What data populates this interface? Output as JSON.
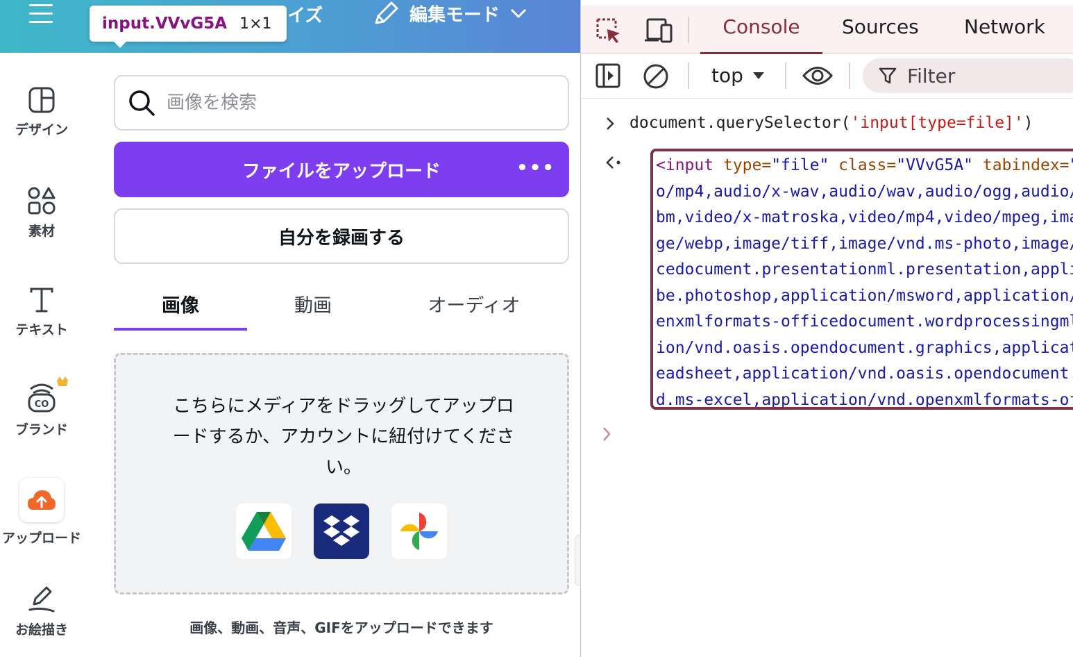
{
  "canva": {
    "topbar": {
      "resize_fragment": "イズ",
      "edit_mode_label": "編集モード"
    },
    "tooltip": {
      "element": "input.VVvG5A",
      "size": "1×1"
    },
    "sidebar": {
      "items": [
        {
          "label": "デザイン",
          "icon": "layout-icon"
        },
        {
          "label": "素材",
          "icon": "shapes-icon"
        },
        {
          "label": "テキスト",
          "icon": "text-icon"
        },
        {
          "label": "ブランド",
          "icon": "brand-icon"
        },
        {
          "label": "アップロード",
          "icon": "cloud-upload-icon"
        },
        {
          "label": "お絵描き",
          "icon": "draw-icon"
        }
      ]
    },
    "search": {
      "placeholder": "画像を検索"
    },
    "upload_button": {
      "label": "ファイルをアップロード",
      "more": "•••"
    },
    "record_button": {
      "label": "自分を録画する"
    },
    "tabs": [
      {
        "label": "画像",
        "active": true
      },
      {
        "label": "動画",
        "active": false
      },
      {
        "label": "オーディオ",
        "active": false
      }
    ],
    "dropzone": {
      "text": "こちらにメディアをドラッグしてアップロードするか、アカウントに紐付けてください。",
      "services": [
        "google-drive-icon",
        "dropbox-icon",
        "google-photos-icon"
      ]
    },
    "footnote": "画像、動画、音声、GIFをアップロードできます",
    "colors": {
      "accent": "#7d3ef0",
      "topbar_start": "#3fb7c8",
      "topbar_end": "#5a84d6"
    }
  },
  "devtools": {
    "tabs": [
      {
        "label": "Console",
        "active": true
      },
      {
        "label": "Sources",
        "active": false
      },
      {
        "label": "Network",
        "active": false
      }
    ],
    "toolbar": {
      "context": "top",
      "filter_placeholder": "Filter"
    },
    "command": {
      "prefix": "document.querySelector(",
      "argument": "'input[type=file]'",
      "suffix": ")"
    },
    "result": {
      "first": {
        "tag_open": "<input",
        "attr1": "type=",
        "val1": "\"file\"",
        "attr2": "class=",
        "val2": "\"VVvG5A\"",
        "attr3": "tabindex=",
        "val3": "\""
      },
      "lines": [
        "o/mp4,audio/x-wav,audio/wav,audio/ogg,audio/",
        "bm,video/x-matroska,video/mp4,video/mpeg,ima",
        "ge/webp,image/tiff,image/vnd.ms-photo,image/",
        "cedocument.presentationml.presentation,appli",
        "be.photoshop,application/msword,application/",
        "enxmlformats-officedocument.wordprocessingml",
        "ion/vnd.oasis.opendocument.graphics,applicat",
        "eadsheet,application/vnd.oasis.opendocument.",
        "d.ms-excel,application/vnd.openxmlformats-of"
      ]
    },
    "colors": {
      "console_accent": "#8a2c3c",
      "tag": "#881280",
      "attr": "#994500",
      "value": "#1a1aa6",
      "string": "#c41a16"
    }
  }
}
